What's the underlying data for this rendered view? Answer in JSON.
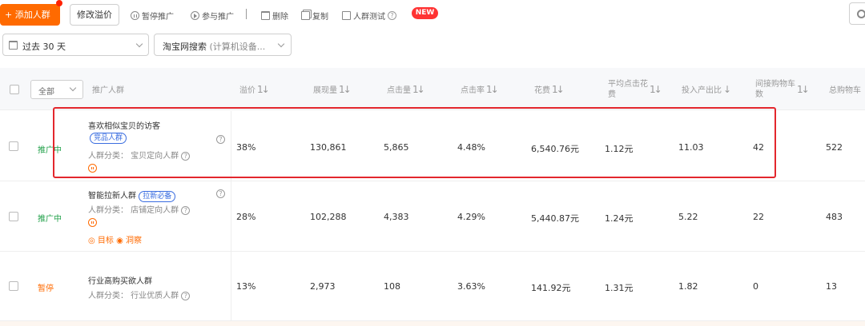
{
  "toolbar": {
    "add_label": "+ 添加人群",
    "modify_label": "修改溢价",
    "pause_label": "暂停推广",
    "join_label": "参与推广",
    "separator": "|",
    "delete_label": "删除",
    "copy_label": "复制",
    "test_label": "人群测试",
    "new_badge": "NEW"
  },
  "filters": {
    "date_range": "过去 30 天",
    "source_main": "淘宝网搜索",
    "source_sub": "(计算机设备..."
  },
  "table": {
    "all_select": "全部",
    "headers": {
      "crowd": "推广人群",
      "premium": "溢价",
      "impressions": "展现量",
      "clicks": "点击量",
      "ctr": "点击率",
      "cost": "花费",
      "avg_cpc_line1": "平均点击花",
      "avg_cpc_line2": "费",
      "roi": "投入产出比",
      "indirect_cart_line1": "间接购物车",
      "indirect_cart_line2": "数",
      "total_cart": "总购物车"
    },
    "sort_glyph": "1↓",
    "sort_down_glyph": "↓",
    "rows": [
      {
        "status": "推广中",
        "name": "喜欢相似宝贝的访客",
        "tag": "竞品人群",
        "category": "人群分类：  宝贝定向人群",
        "premium": "38%",
        "impressions": "130,861",
        "clicks": "5,865",
        "ctr": "4.48%",
        "cost": "6,540.76元",
        "avg_cpc": "1.12元",
        "roi": "11.03",
        "indirect_cart": "42",
        "total_cart": "522"
      },
      {
        "status": "推广中",
        "name": "智能拉新人群",
        "tag": "拉新必备",
        "category": "人群分类：  店铺定向人群",
        "links": "◎ 目标  ◉ 洞察",
        "premium": "28%",
        "impressions": "102,288",
        "clicks": "4,383",
        "ctr": "4.29%",
        "cost": "5,440.87元",
        "avg_cpc": "1.24元",
        "roi": "5.22",
        "indirect_cart": "22",
        "total_cart": "483"
      },
      {
        "status": "暂停",
        "name": "行业高购买欲人群",
        "category": "人群分类：  行业优质人群",
        "premium": "13%",
        "impressions": "2,973",
        "clicks": "108",
        "ctr": "3.63%",
        "cost": "141.92元",
        "avg_cpc": "1.31元",
        "roi": "1.82",
        "indirect_cart": "0",
        "total_cart": "13"
      }
    ]
  },
  "colors": {
    "accent": "#ff6a00",
    "status_active": "#22a14a",
    "tag_blue": "#3a6de0",
    "highlight_red": "#e3272d",
    "new_badge": "#ff3333"
  },
  "icons": [
    "pause-icon",
    "play-icon",
    "trash-icon",
    "copy-icon",
    "crowd-test-icon",
    "help-icon",
    "gear-icon",
    "calendar-icon",
    "chevron-down-icon"
  ]
}
